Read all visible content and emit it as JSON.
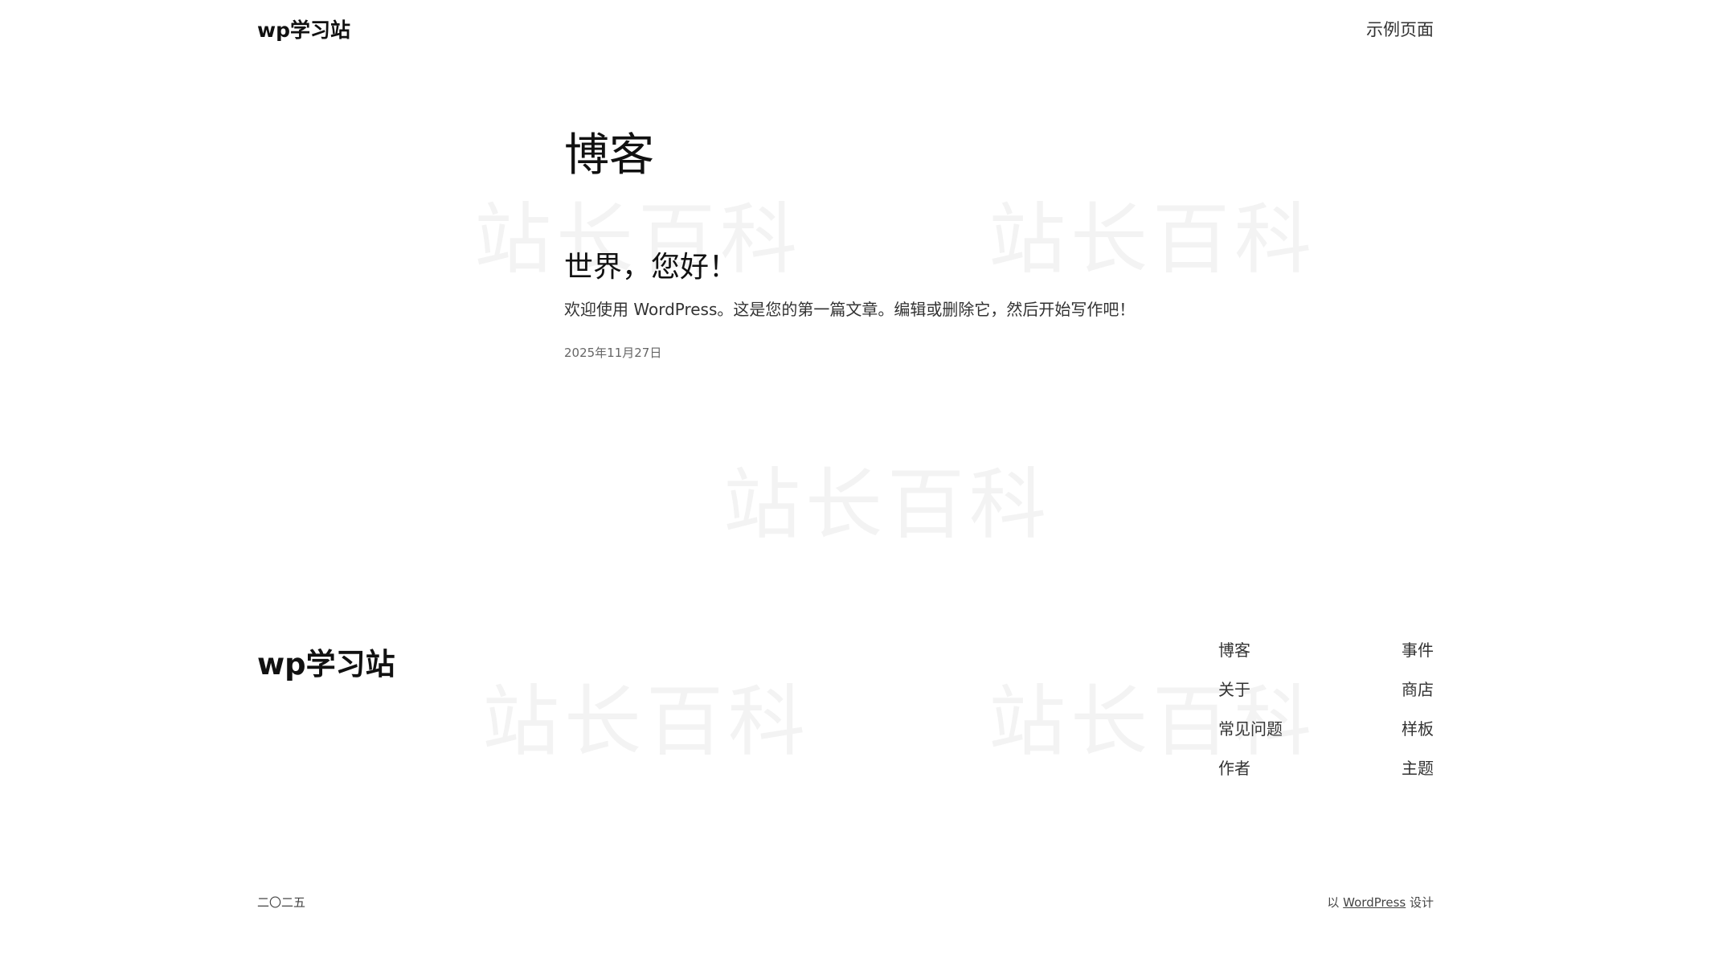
{
  "header": {
    "site_title": "wp学习站",
    "nav_link": "示例页面"
  },
  "main": {
    "page_heading": "博客",
    "post": {
      "title": "世界，您好！",
      "excerpt": "欢迎使用 WordPress。这是您的第一篇文章。编辑或删除它，然后开始写作吧！",
      "date": "2025年11月27日"
    }
  },
  "footer": {
    "site_title": "wp学习站",
    "nav_left": [
      "博客",
      "关于",
      "常见问题",
      "作者"
    ],
    "nav_right": [
      "事件",
      "商店",
      "样板",
      "主题"
    ],
    "year": "二〇二五",
    "credit_prefix": "以 ",
    "credit_link": "WordPress",
    "credit_suffix": " 设计"
  },
  "watermark_text": "站长百科"
}
